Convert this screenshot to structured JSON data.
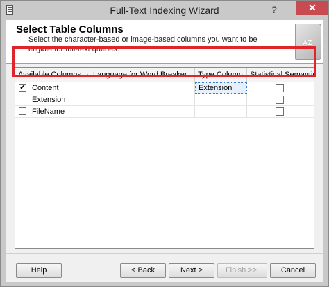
{
  "window": {
    "title": "Full-Text Indexing Wizard",
    "help_glyph": "?",
    "close_glyph": "✕"
  },
  "header": {
    "title": "Select Table Columns",
    "description": "Select the character-based or image-based columns you want to be eligible for full-text queries.",
    "book_label": "AZ"
  },
  "grid": {
    "columns": [
      "Available Columns",
      "Language for Word Breaker",
      "Type Column",
      "Statistical Semantics"
    ],
    "sort_glyph": "▲",
    "rows": [
      {
        "name": "Content",
        "checked": true,
        "language": "",
        "type_column": "Extension",
        "statistical": false
      },
      {
        "name": "Extension",
        "checked": false,
        "language": "",
        "type_column": "",
        "statistical": false
      },
      {
        "name": "FileName",
        "checked": false,
        "language": "",
        "type_column": "",
        "statistical": false
      }
    ]
  },
  "buttons": {
    "help": "Help",
    "back": "< Back",
    "next": "Next >",
    "finish": "Finish >>|",
    "cancel": "Cancel"
  },
  "colors": {
    "highlight": "#e0242b",
    "close_bg": "#c74b50"
  }
}
